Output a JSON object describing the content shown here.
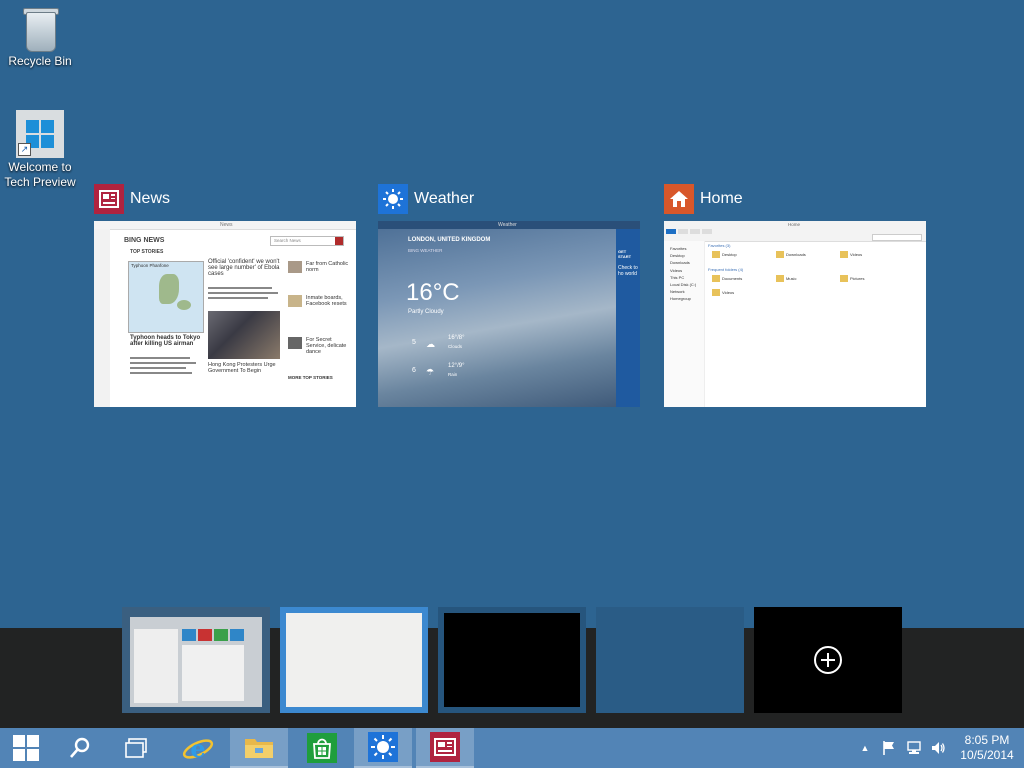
{
  "desktop": {
    "icons": [
      {
        "label": "Recycle Bin"
      },
      {
        "label_line1": "Welcome to",
        "label_line2": "Tech Preview"
      }
    ]
  },
  "task_view": {
    "windows": [
      {
        "title": "News",
        "accent": "#b0233f",
        "icon": "news-icon"
      },
      {
        "title": "Weather",
        "accent": "#1e73d8",
        "icon": "sun-icon"
      },
      {
        "title": "Home",
        "accent": "#d8572a",
        "icon": "home-icon"
      }
    ],
    "news_preview": {
      "window_title": "News",
      "brand": "BING NEWS",
      "section": "TOP STORIES",
      "search_placeholder": "Search News",
      "map_caption": "Typhoon Phanfone",
      "headline_1": "Typhoon heads to Tokyo after killing US airman",
      "headline_2": "Official 'confident' we won't see large number' of Ebola cases",
      "headline_3": "Hong Kong Protesters Urge Government To Begin",
      "side_1": "Far from Catholic norm",
      "side_2": "Inmate boards, Facebook resets",
      "side_3": "For Secret Service, delicate dance",
      "more": "MORE TOP STORIES"
    },
    "weather_preview": {
      "window_title": "Weather",
      "location": "LONDON, UNITED KINGDOM",
      "brand": "BING WEATHER",
      "temp": "16°C",
      "condition": "Partly Cloudy",
      "day1": "5",
      "day1_range": "16°/8°",
      "day1_cond": "Clouds",
      "day2": "6",
      "day2_range": "12°/9°",
      "day2_cond": "Rain",
      "side_label": "GET START",
      "side_text": "Check to ho world"
    },
    "home_preview": {
      "window_title": "Home",
      "favorites": "Favorites (3)",
      "frequent": "Frequent folders (4)",
      "nav": [
        "Favorites",
        "Desktop",
        "Downloads",
        "Videos",
        "This PC",
        "Local Disk (C:)",
        "Network",
        "Homegroup"
      ],
      "folders": [
        "Desktop",
        "Downloads",
        "Videos",
        "Documents",
        "Music",
        "Pictures",
        "Videos"
      ]
    }
  },
  "virtual_desktops": {
    "count": 4,
    "add_label": "+"
  },
  "taskbar": {
    "buttons": [
      "start-icon",
      "search-icon",
      "task-view-icon",
      "internet-explorer-icon",
      "file-explorer-icon",
      "store-icon",
      "weather-icon",
      "news-icon"
    ],
    "time": "8:05 PM",
    "date": "10/5/2014"
  }
}
